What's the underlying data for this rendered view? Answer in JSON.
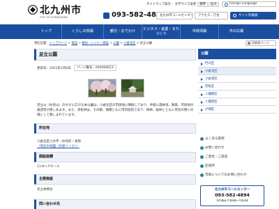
{
  "header": {
    "logo_title": "北九州市",
    "logo_sub": "CITY OF KITAKYUSHU",
    "util_links": [
      "サイトマップ",
      "表示・ 文字サイズ変更"
    ],
    "font_sizes": [
      "標準",
      "拡大"
    ],
    "language_label": "Foreign Language",
    "tel": "093-582-4894",
    "callcenter_label": "北九州市コールセンター",
    "access_label": "アクセス・庁舎",
    "search_label": "サイト内検索"
  },
  "nav": {
    "items": [
      "トップ",
      "くらしの情報",
      "観光・おでかけ",
      "ビジネス・産業・まちづくり",
      "市政情報",
      "市の広報"
    ]
  },
  "breadcrumb": {
    "prefix": "現在位置：",
    "items": [
      "トップページ",
      "施設",
      "観光・レジャー施設",
      "公園",
      "小倉北区"
    ],
    "current": "足立公園"
  },
  "print_label": "印刷用ページ",
  "main": {
    "title": "足立公園",
    "updated": "更新日：2021年1月6日",
    "page_no": "ページ番号：000006613",
    "description": "足立山（妙見山）のすそに広がる本公園は、小倉北区の市街地に隣接しており、手軽に森林浴、散策、市街地の展望等が楽しめます。また、赤松林は、その数、規模ともに市内屈指であり、梅林、桜林とともに市民の憩いの場として親しまれています。",
    "sections": [
      {
        "heading": "所在地",
        "text": "小倉北区小文字・妙見町・黒原",
        "link": "（周辺の地図（外部リンク））"
      },
      {
        "heading": "開設面積",
        "text": "13.8ヘクタール"
      },
      {
        "heading": "主要施設",
        "text": "足立休憩舎"
      },
      {
        "heading": "問い合わせ先"
      }
    ]
  },
  "side": {
    "heading": "公園",
    "items": [
      "門司区",
      "小倉北区",
      "小倉南区",
      "若松区",
      "八幡東区",
      "八幡西区",
      "戸畑区"
    ],
    "active_item": "小倉北区",
    "links": [
      "よくある質問",
      "お問い合わせ",
      "ご意見・ご提案",
      "区役所",
      "市政についてのお問い合わせ"
    ],
    "callcenter": {
      "title": "北九州市コールセンター",
      "tel": "093-582-4894",
      "hours": "年中無休 午前8時〜午後9時"
    }
  },
  "colors": {
    "brand_blue": "#1a4ea0",
    "section_bg": "#eef1f7"
  }
}
